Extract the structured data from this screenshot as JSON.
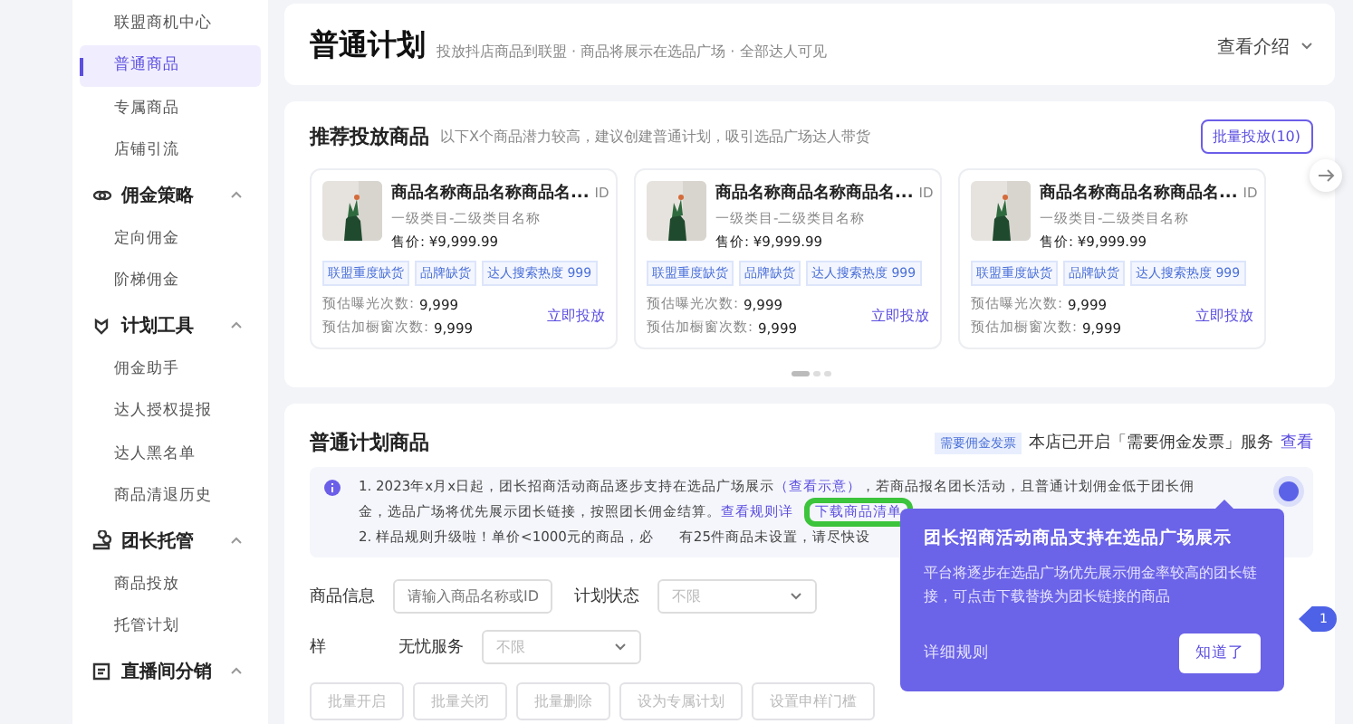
{
  "sidebar": {
    "items": [
      {
        "label": "联盟商机中心",
        "selected": false
      },
      {
        "label": "普通商品",
        "selected": true
      },
      {
        "label": "专属商品",
        "selected": false
      },
      {
        "label": "店铺引流",
        "selected": false
      }
    ],
    "groups": [
      {
        "title": "佣金策略",
        "kind": "coins",
        "expanded": true,
        "children": [
          {
            "label": "定向佣金",
            "selected": false
          },
          {
            "label": "阶梯佣金",
            "selected": false
          }
        ]
      },
      {
        "title": "计划工具",
        "kind": "tools",
        "expanded": true,
        "children": [
          {
            "label": "佣金助手",
            "selected": false
          },
          {
            "label": "达人授权提报",
            "selected": false
          },
          {
            "label": "达人黑名单",
            "selected": false
          },
          {
            "label": "商品清退历史",
            "selected": false
          }
        ]
      },
      {
        "title": "团长托管",
        "kind": "people",
        "expanded": true,
        "children": [
          {
            "label": "商品投放",
            "selected": false
          },
          {
            "label": "托管计划",
            "selected": false
          }
        ]
      },
      {
        "title": "直播间分销",
        "kind": "live",
        "expanded": true
      }
    ]
  },
  "header": {
    "title": "普通计划",
    "subtitle": "投放抖店商品到联盟 · 商品将展示在选品广场 · 全部达人可见",
    "intro": "查看介绍"
  },
  "recommend": {
    "title": "推荐投放商品",
    "hint": "以下X个商品潜力较高，建议创建普通计划，吸引选品广场达人带货",
    "batch_button": "批量投放(10)",
    "products": [
      {
        "name": "商品名称商品名称商品名...",
        "id": "ID",
        "category": "一级类目-二级类目名称",
        "price": "售价: ¥9,999.99",
        "tags": [
          "联盟重度缺货",
          "品牌缺货",
          "达人搜索热度 999"
        ],
        "stats": [
          {
            "label": "预估曝光次数:",
            "value": "9,999"
          },
          {
            "label": "预估加橱窗次数:",
            "value": "9,999"
          }
        ],
        "action": "立即投放"
      },
      {
        "name": "商品名称商品名称商品名...",
        "id": "ID",
        "category": "一级类目-二级类目名称",
        "price": "售价: ¥9,999.99",
        "tags": [
          "联盟重度缺货",
          "品牌缺货",
          "达人搜索热度 999"
        ],
        "stats": [
          {
            "label": "预估曝光次数:",
            "value": "9,999"
          },
          {
            "label": "预估加橱窗次数:",
            "value": "9,999"
          }
        ],
        "action": "立即投放"
      },
      {
        "name": "商品名称商品名称商品名...",
        "id": "ID",
        "category": "一级类目-二级类目名称",
        "price": "售价: ¥9,999.99",
        "tags": [
          "联盟重度缺货",
          "品牌缺货",
          "达人搜索热度 999"
        ],
        "stats": [
          {
            "label": "预估曝光次数:",
            "value": "9,999"
          },
          {
            "label": "预估加橱窗次数:",
            "value": "9,999"
          }
        ],
        "action": "立即投放"
      }
    ],
    "pages": [
      {
        "selected": true
      },
      {
        "selected": false
      },
      {
        "selected": false
      }
    ]
  },
  "section": {
    "title": "普通计划商品",
    "invoice_tag": "需要佣金发票",
    "invoice_text": "本店已开启「需要佣金发票」服务",
    "invoice_link": "查看",
    "notice": {
      "line1_before": "1. 2023年x月x日起，团长招商活动商品逐步支持在选品广场展示",
      "line1_link": "（查看示意）",
      "line1_after": "，若商品报名团长活动，且普通计划佣金低于团长佣金，选品广场将优先展示团长链接，按照团长佣金结算。",
      "rules_link": "查看规则详",
      "download_link": "下载商品清单",
      "line2_start": "2. 样品规则升级啦！单价<1000元的商品，必",
      "line2_end": "有25件商品未设置，请尽快设"
    },
    "filters": [
      {
        "label": "商品信息",
        "kind": "input",
        "placeholder": "请输入商品名称或ID"
      },
      {
        "label": "计划状态",
        "kind": "select",
        "placeholder": "不限"
      },
      {
        "label": "样",
        "kind": "label"
      },
      {
        "label": "无忧服务",
        "kind": "select",
        "placeholder": "不限"
      }
    ],
    "buttons": [
      "批量开启",
      "批量关闭",
      "批量删除",
      "设为专属计划",
      "设置申样门槛"
    ]
  },
  "popover": {
    "title": "团长招商活动商品支持在选品广场展示",
    "body": "平台将逐步在选品广场优先展示佣金率较高的团长链接，可点击下载替换为团长链接的商品",
    "rules": "详细规则",
    "ok": "知道了",
    "step": "1"
  }
}
